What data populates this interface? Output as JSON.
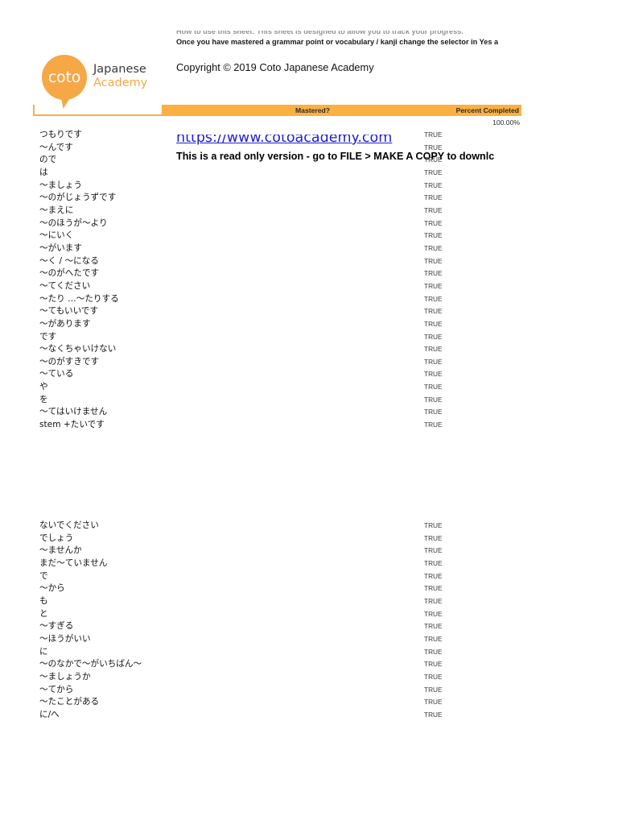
{
  "header": {
    "instruction_line_1": "How to use this sheet: This sheet is designed to allow you to track your progress.",
    "instruction_line_2": "Once you have mastered a grammar point or vocabulary / kanji  change the selector in Yes a",
    "copyright": "Copyright © 2019 Coto Japanese Academy",
    "url": "https://www.cotoacademy.com",
    "readonly_notice": "This is a read only version - go to FILE > MAKE A COPY to downlc",
    "logo": {
      "mark_text": "coto",
      "word_line_1": "Japanese",
      "word_line_2": "Academy"
    },
    "columns": {
      "mastered": "Mastered?",
      "percent_completed": "Percent Completed"
    },
    "percent_completed_value": "100.00%"
  },
  "colors": {
    "brand_orange": "#FBB040",
    "logo_orange": "#F6A746",
    "link_blue": "#2020D0",
    "text_dark": "#111111"
  },
  "blocks": [
    {
      "rows": [
        {
          "term": "つもりです",
          "mastered": "TRUE"
        },
        {
          "term": "〜んです",
          "mastered": "TRUE"
        },
        {
          "term": "ので",
          "mastered": "TRUE"
        },
        {
          "term": "は",
          "mastered": "TRUE"
        },
        {
          "term": "〜ましょう",
          "mastered": "TRUE"
        },
        {
          "term": "〜のがじょうずです",
          "mastered": "TRUE"
        },
        {
          "term": "〜まえに",
          "mastered": "TRUE"
        },
        {
          "term": "〜のほうが〜より",
          "mastered": "TRUE"
        },
        {
          "term": "〜にいく",
          "mastered": "TRUE"
        },
        {
          "term": "〜がいます",
          "mastered": "TRUE"
        },
        {
          "term": "〜く / 〜になる",
          "mastered": "TRUE"
        },
        {
          "term": "〜のがへたです",
          "mastered": "TRUE"
        },
        {
          "term": "〜てください",
          "mastered": "TRUE"
        },
        {
          "term": "〜たり …〜たりする",
          "mastered": "TRUE"
        },
        {
          "term": "〜てもいいです",
          "mastered": "TRUE"
        },
        {
          "term": "〜があります",
          "mastered": "TRUE"
        },
        {
          "term": "です",
          "mastered": "TRUE"
        },
        {
          "term": "〜なくちゃいけない",
          "mastered": "TRUE"
        },
        {
          "term": "〜のがすきです",
          "mastered": "TRUE"
        },
        {
          "term": "〜ている",
          "mastered": "TRUE"
        },
        {
          "term": "や",
          "mastered": "TRUE"
        },
        {
          "term": "を",
          "mastered": "TRUE"
        },
        {
          "term": "〜てはいけません",
          "mastered": "TRUE"
        },
        {
          "term": "stem +たいです",
          "mastered": "TRUE"
        }
      ]
    },
    {
      "rows": [
        {
          "term": "ないでください",
          "mastered": "TRUE"
        },
        {
          "term": "でしょう",
          "mastered": "TRUE"
        },
        {
          "term": "〜ませんか",
          "mastered": "TRUE"
        },
        {
          "term": "まだ〜ていません",
          "mastered": "TRUE"
        },
        {
          "term": "で",
          "mastered": "TRUE"
        },
        {
          "term": "〜から",
          "mastered": "TRUE"
        },
        {
          "term": "も",
          "mastered": "TRUE"
        },
        {
          "term": "と",
          "mastered": "TRUE"
        },
        {
          "term": "〜すぎる",
          "mastered": "TRUE"
        },
        {
          "term": "〜ほうがいい",
          "mastered": "TRUE"
        },
        {
          "term": "に",
          "mastered": "TRUE"
        },
        {
          "term": "〜のなかで〜がいちばん〜",
          "mastered": "TRUE"
        },
        {
          "term": "〜ましょうか",
          "mastered": "TRUE"
        },
        {
          "term": "〜てから",
          "mastered": "TRUE"
        },
        {
          "term": "〜たことがある",
          "mastered": "TRUE"
        },
        {
          "term": "に/へ",
          "mastered": "TRUE"
        }
      ]
    }
  ]
}
